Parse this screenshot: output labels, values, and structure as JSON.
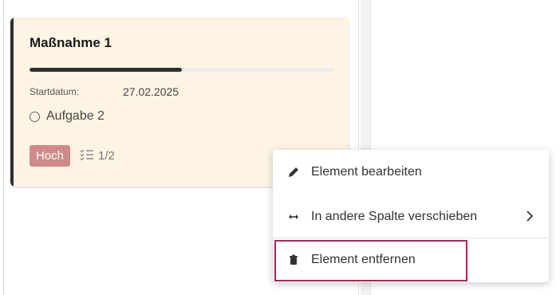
{
  "card": {
    "title": "Maßnahme 1",
    "progress_fraction": 0.5,
    "start_label": "Startdatum:",
    "start_date": "27.02.2025",
    "task_label": "Aufgabe 2",
    "priority_label": "Hoch",
    "subtasks_count": "1/2",
    "colors": {
      "background": "#fdf4e4",
      "accent": "#2f2f2f",
      "priority": "#d18a8a"
    }
  },
  "context_menu": {
    "items": [
      {
        "label": "Element bearbeiten",
        "icon": "pencil-icon"
      },
      {
        "label": "In andere Spalte verschieben",
        "icon": "arrows-horizontal-icon",
        "has_submenu": true
      },
      {
        "label": "Element entfernen",
        "icon": "trash-icon"
      }
    ],
    "highlight_color": "#c2185b"
  }
}
